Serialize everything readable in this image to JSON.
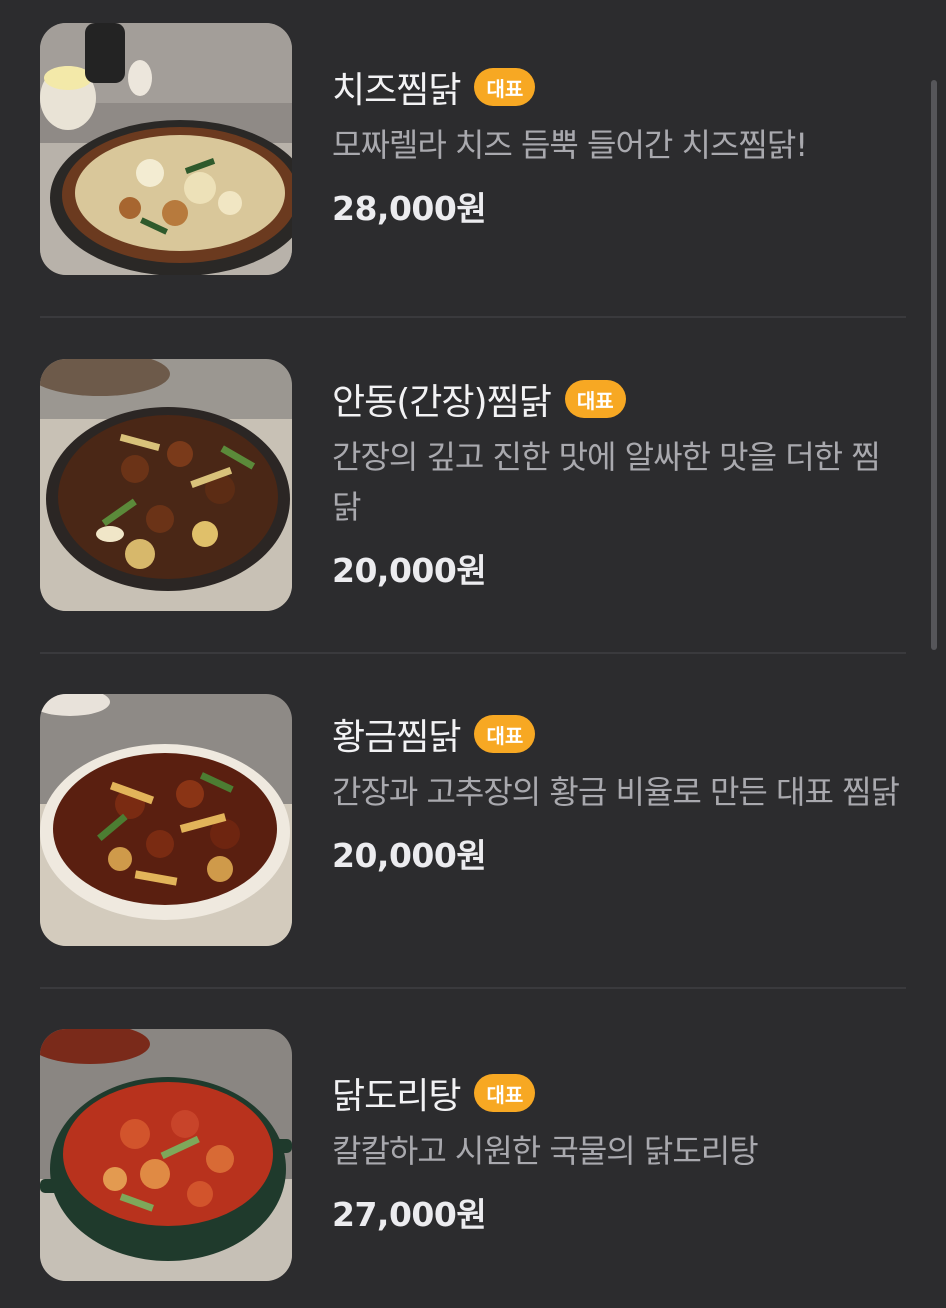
{
  "menu": {
    "items": [
      {
        "name": "치즈찜닭",
        "badge": "대표",
        "description": "모짜렐라 치즈 듬뿍 들어간 치즈찜닭!",
        "price": "28,000원",
        "image_icon": "cheese-jjimdak-photo"
      },
      {
        "name": "안동(간장)찜닭",
        "badge": "대표",
        "description": "간장의 깊고 진한 맛에 알싸한 맛을 더한 찜닭",
        "price": "20,000원",
        "image_icon": "andong-jjimdak-photo"
      },
      {
        "name": "황금찜닭",
        "badge": "대표",
        "description": "간장과 고추장의 황금 비율로 만든 대표 찜닭",
        "price": "20,000원",
        "image_icon": "golden-jjimdak-photo"
      },
      {
        "name": "닭도리탕",
        "badge": "대표",
        "description": "칼칼하고 시원한 국물의 닭도리탕",
        "price": "27,000원",
        "image_icon": "dakdoritang-photo"
      }
    ]
  },
  "colors": {
    "background": "#2c2c2e",
    "badge": "#f7a823",
    "title": "#f2f2f4",
    "description": "#a9a9ae",
    "price": "#ececef",
    "divider": "#3a3a3d"
  }
}
